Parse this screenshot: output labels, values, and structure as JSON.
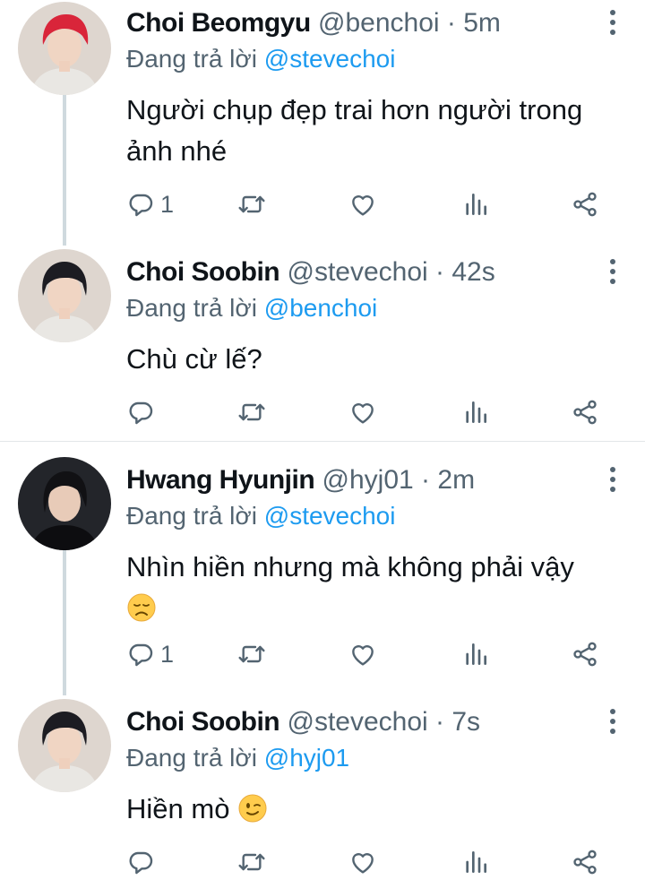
{
  "tweets": [
    {
      "name": "Choi Beomgyu",
      "handle": "@benchoi",
      "separator": "·",
      "time": "5m",
      "reply_prefix": "Đang trả lời",
      "reply_to": "@stevechoi",
      "text_line1": "Người chụp đẹp trai hơn người trong",
      "text_line2": "ảnh nhé",
      "reply_count": "1",
      "avatar_hair": "#d9253a"
    },
    {
      "name": "Choi Soobin",
      "handle": "@stevechoi",
      "separator": "·",
      "time": "42s",
      "reply_prefix": "Đang trả lời",
      "reply_to": "@benchoi",
      "text_line1": "Chù cừ lế?",
      "reply_count": "",
      "avatar_hair": "#1c1c22"
    },
    {
      "name": "Hwang Hyunjin",
      "handle": "@hyj01",
      "separator": "·",
      "time": "2m",
      "reply_prefix": "Đang trả lời",
      "reply_to": "@stevechoi",
      "text_line1": "Nhìn hiền nhưng mà không phải vậy",
      "text_emoji": "disappointed-face",
      "reply_count": "1",
      "avatar_hair": "#111114"
    },
    {
      "name": "Choi Soobin",
      "handle": "@stevechoi",
      "separator": "·",
      "time": "7s",
      "reply_prefix": "Đang trả lời",
      "reply_to": "@hyj01",
      "text_line1": "Hiền mò",
      "text_emoji": "winking-face",
      "reply_count": "",
      "avatar_hair": "#1c1c22"
    }
  ],
  "colors": {
    "accent": "#1d9bf0",
    "secondary_text": "#536471",
    "thread_line": "#cfd9de"
  }
}
